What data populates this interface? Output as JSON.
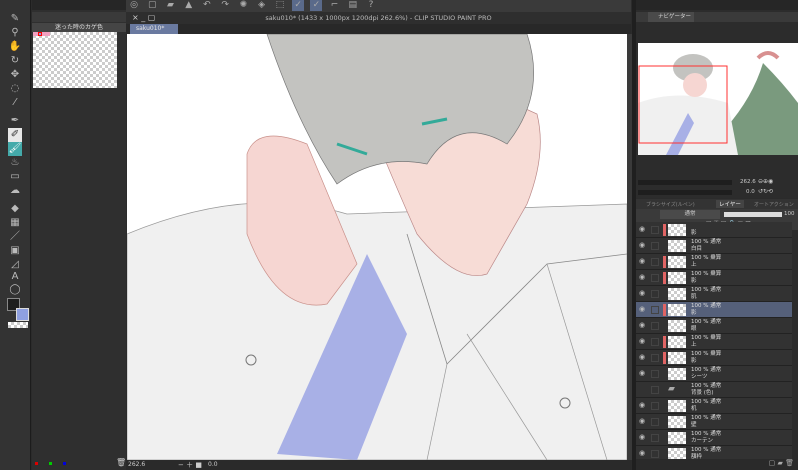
{
  "window": {
    "title": "saku010* (1433 x 1000px 1200dpi 262.6%) - CLIP STUDIO PAINT PRO",
    "tab": "saku010*"
  },
  "color_set": {
    "title": "迷った時のカゲ色"
  },
  "navigator": {
    "tab": "ナビゲーター",
    "zoom": "262.6",
    "rotation": "0.0"
  },
  "status": {
    "zoom": "262.6",
    "rotation": "0.0"
  },
  "layer_panel": {
    "tabs": [
      "ブラシサイズ(ルペン)",
      "レイヤー",
      "オートアクション"
    ],
    "blend_mode": "通常",
    "opacity": "100",
    "layers": [
      {
        "meta": "",
        "name": "影",
        "clip": true,
        "visible": true
      },
      {
        "meta": "100 % 通常",
        "name": "白目",
        "clip": false,
        "visible": true
      },
      {
        "meta": "100 % 乗算",
        "name": "上",
        "clip": true,
        "visible": true
      },
      {
        "meta": "100 % 乗算",
        "name": "影",
        "clip": true,
        "visible": true
      },
      {
        "meta": "100 % 通常",
        "name": "肌",
        "clip": false,
        "visible": true
      },
      {
        "meta": "100 % 通常",
        "name": "影",
        "clip": true,
        "visible": true,
        "selected": true
      },
      {
        "meta": "100 % 通常",
        "name": "眼",
        "clip": false,
        "visible": true
      },
      {
        "meta": "100 % 乗算",
        "name": "上",
        "clip": true,
        "visible": true
      },
      {
        "meta": "100 % 乗算",
        "name": "影",
        "clip": true,
        "visible": true
      },
      {
        "meta": "100 % 通常",
        "name": "シーツ",
        "clip": false,
        "visible": true
      },
      {
        "meta": "100 % 通常",
        "name": "背景 (色)",
        "clip": false,
        "visible": false,
        "folder": true
      },
      {
        "meta": "100 % 通常",
        "name": "机",
        "clip": false,
        "visible": true
      },
      {
        "meta": "100 % 通常",
        "name": "壁",
        "clip": false,
        "visible": true
      },
      {
        "meta": "100 % 通常",
        "name": "カーテン",
        "clip": false,
        "visible": true
      },
      {
        "meta": "100 % 通常",
        "name": "額枠",
        "clip": false,
        "visible": true
      }
    ]
  },
  "colors": {
    "accent": "#55607a",
    "clip": "#e06464",
    "nav_frame": "#ff3030",
    "main_color": "#1e1e1e",
    "sub_color": "#8fa0e0"
  }
}
